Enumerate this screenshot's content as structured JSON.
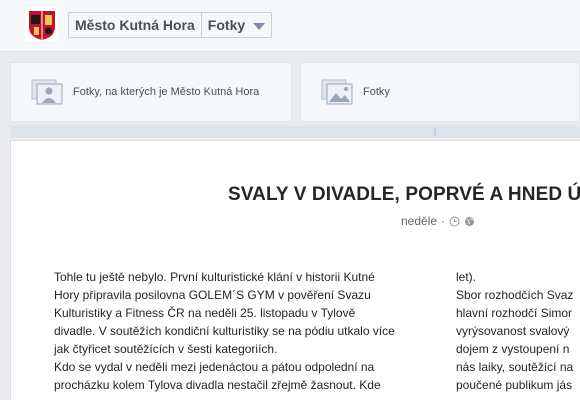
{
  "header": {
    "page_name": "Město Kutná Hora",
    "section": "Fotky"
  },
  "tiles": [
    {
      "label": "Fotky, na kterých je Město Kutná Hora",
      "icon": "tagged-photos-icon"
    },
    {
      "label": "Fotky",
      "icon": "photos-icon"
    }
  ],
  "post": {
    "title": "SVALY V DIVADLE, POPRVÉ A HNED ÚS",
    "day": "neděle",
    "separator": "·",
    "column1": [
      "Tohle tu ještě nebylo. První kulturistické klání v historii Kutné",
      "Hory připravila posilovna GOLEM´S GYM v pověření Svazu",
      "Kulturistiky a Fitness ČR na neděli 25. listopadu v Tylově",
      "divadle. V soutěžích kondiční kulturistiky se na pódiu utkalo více",
      "jak čtyřicet soutěžících v šesti kategoriích.",
      "Kdo se vydal v neděli mezi jedenáctou a pátou odpolední na",
      "procházku kolem Tylova divadla nestačil zřejmě žasnout. Kde"
    ],
    "column2": [
      "let).",
      "Sbor rozhodčích Svaz",
      "hlavní rozhodčí Simor",
      "vyrýsovanost svalový",
      "dojem z vystoupení n",
      "nás laiky, soutěžící na",
      "poučené publikum jás"
    ]
  },
  "colors": {
    "header_bg": "#f6f7f9",
    "page_bg": "#e9ebee",
    "icon_blue": "#7f8ba5"
  }
}
